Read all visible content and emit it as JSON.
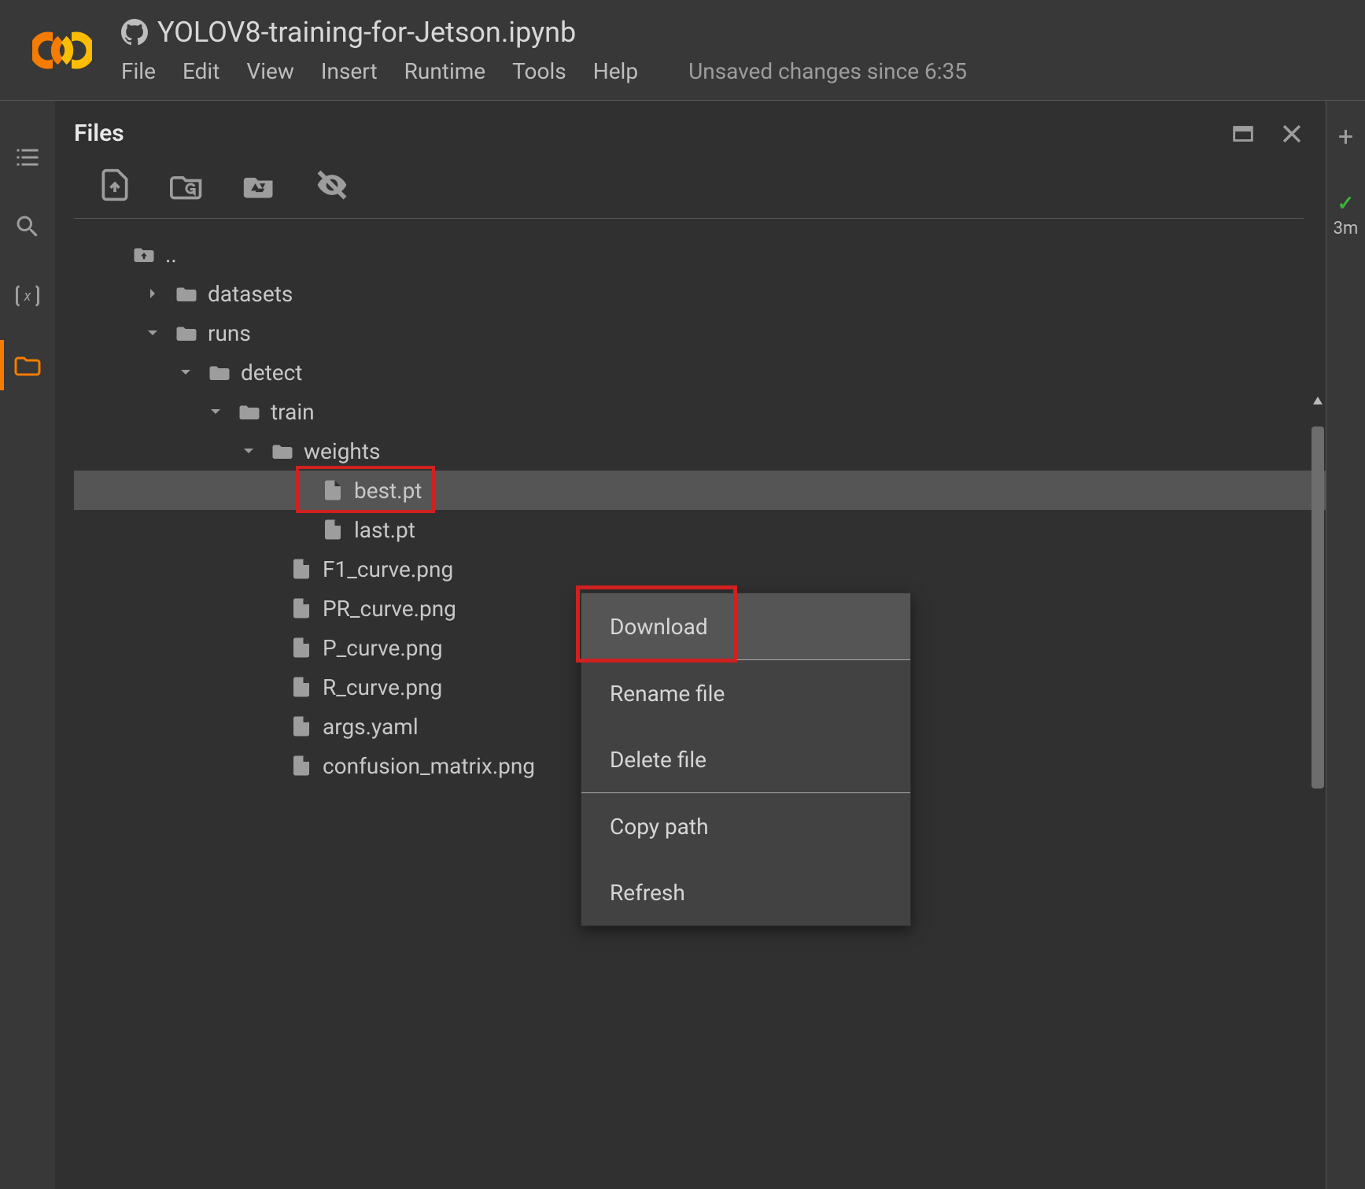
{
  "header": {
    "notebook_title": "YOLOV8-training-for-Jetson.ipynb",
    "menu": [
      "File",
      "Edit",
      "View",
      "Insert",
      "Runtime",
      "Tools",
      "Help"
    ],
    "status": "Unsaved changes since 6:35"
  },
  "iconbar": {
    "toc": "toc-icon",
    "search": "search-icon",
    "vars": "variables-icon",
    "folder": "folder-icon"
  },
  "panel": {
    "title": "Files",
    "toolbar": {
      "upload": "upload-icon",
      "refresh": "refresh-folder-icon",
      "mount": "drive-icon",
      "hidden": "toggle-hidden-icon"
    },
    "actions": {
      "detach": "new-window-icon",
      "close": "close-icon"
    }
  },
  "tree": {
    "parent": "..",
    "nodes": [
      {
        "name": "datasets",
        "type": "folder",
        "expanded": false,
        "depth": 1
      },
      {
        "name": "runs",
        "type": "folder",
        "expanded": true,
        "depth": 1,
        "children": [
          {
            "name": "detect",
            "type": "folder",
            "expanded": true,
            "depth": 2,
            "children": [
              {
                "name": "train",
                "type": "folder",
                "expanded": true,
                "depth": 3,
                "children": [
                  {
                    "name": "weights",
                    "type": "folder",
                    "expanded": true,
                    "depth": 4,
                    "children": [
                      {
                        "name": "best.pt",
                        "type": "file",
                        "depth": 5,
                        "selected": true,
                        "highlight": true
                      },
                      {
                        "name": "last.pt",
                        "type": "file",
                        "depth": 5
                      }
                    ]
                  },
                  {
                    "name": "F1_curve.png",
                    "type": "file",
                    "depth": 4
                  },
                  {
                    "name": "PR_curve.png",
                    "type": "file",
                    "depth": 4
                  },
                  {
                    "name": "P_curve.png",
                    "type": "file",
                    "depth": 4
                  },
                  {
                    "name": "R_curve.png",
                    "type": "file",
                    "depth": 4
                  },
                  {
                    "name": "args.yaml",
                    "type": "file",
                    "depth": 4
                  },
                  {
                    "name": "confusion_matrix.png",
                    "type": "file",
                    "depth": 4
                  }
                ]
              }
            ]
          }
        ]
      }
    ]
  },
  "context_menu": {
    "groups": [
      [
        "Download"
      ],
      [
        "Rename file",
        "Delete file"
      ],
      [
        "Copy path",
        "Refresh"
      ]
    ],
    "highlighted": "Download"
  },
  "right": {
    "plus": "+",
    "check": "✓",
    "runtime": "3m"
  }
}
